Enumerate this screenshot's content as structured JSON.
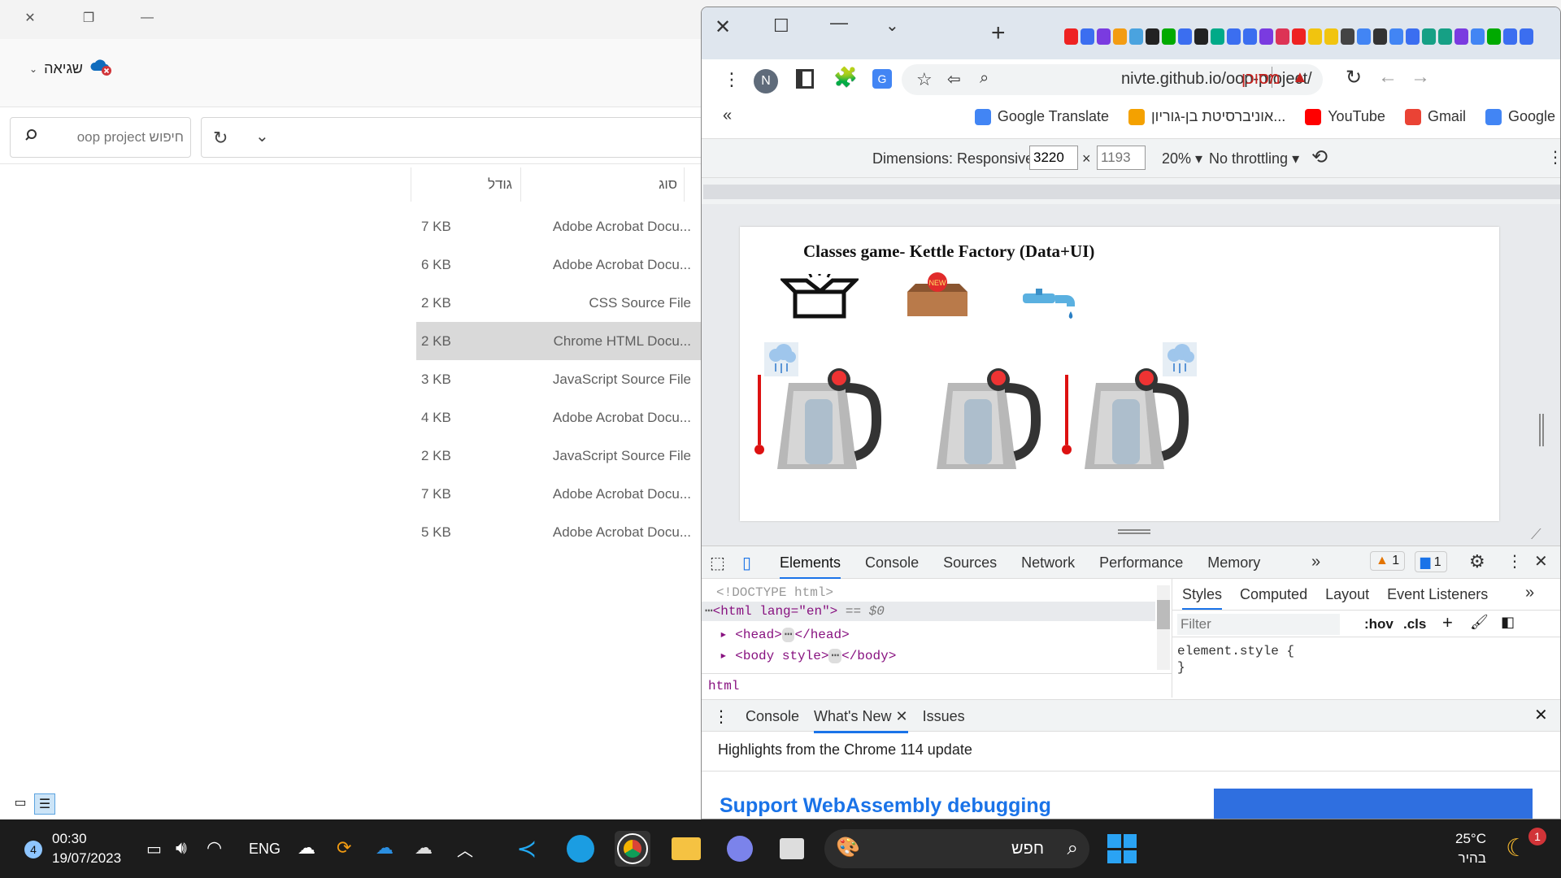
{
  "explorer": {
    "status_label": "שגיאה",
    "search_placeholder": "חיפוש oop project",
    "columns": {
      "type": "סוג",
      "size": "גודל"
    },
    "rows": [
      {
        "size": "7 KB",
        "type": "Adobe Acrobat Docu..."
      },
      {
        "size": "6 KB",
        "type": "Adobe Acrobat Docu..."
      },
      {
        "size": "2 KB",
        "type": "CSS Source File"
      },
      {
        "size": "2 KB",
        "type": "Chrome HTML Docu...",
        "selected": true
      },
      {
        "size": "3 KB",
        "type": "JavaScript Source File"
      },
      {
        "size": "4 KB",
        "type": "Adobe Acrobat Docu..."
      },
      {
        "size": "2 KB",
        "type": "JavaScript Source File"
      },
      {
        "size": "7 KB",
        "type": "Adobe Acrobat Docu..."
      },
      {
        "size": "5 KB",
        "type": "Adobe Acrobat Docu..."
      }
    ]
  },
  "chrome": {
    "profile_initial": "N",
    "url": "nivte.github.io/oop-project/",
    "security_label": "מסוכן",
    "bookmarks": [
      {
        "label": "Google",
        "icon": "google-icon",
        "color": "#4285f4"
      },
      {
        "label": "Gmail",
        "icon": "gmail-icon",
        "color": "#ea4335"
      },
      {
        "label": "YouTube",
        "icon": "youtube-icon",
        "color": "#ff0000"
      },
      {
        "label": "אוניברסיטת בן-גוריון...",
        "icon": "bgu-icon",
        "color": "#f4a100"
      },
      {
        "label": "Google Translate",
        "icon": "translate-icon",
        "color": "#4285f4"
      }
    ],
    "device_toolbar": {
      "dimensions": "Dimensions: Responsive",
      "width": "3220",
      "height": "1193",
      "zoom": "20%",
      "throttling": "No throttling"
    },
    "page": {
      "title": "Classes game- Kettle Factory (Data+UI)"
    },
    "devtools": {
      "tabs": [
        "Elements",
        "Console",
        "Sources",
        "Network",
        "Performance",
        "Memory"
      ],
      "warnings": "1",
      "messages": "1",
      "dom_lines": [
        "<!DOCTYPE html>",
        "<html lang=\"en\">",
        "== $0",
        "<head>",
        "</head>",
        "<body style>",
        "</body>"
      ],
      "breadcrumb": "html",
      "styles_tabs": [
        "Styles",
        "Computed",
        "Layout",
        "Event Listeners"
      ],
      "filter_placeholder": "Filter",
      "hov": ":hov",
      "cls": ".cls",
      "element_style": "element.style {",
      "close_brace": "}",
      "drawer_tabs": [
        "Console",
        "What's New",
        "Issues"
      ],
      "highlights": "Highlights from the Chrome 114 update",
      "feature_title": "Support WebAssembly debugging"
    }
  },
  "taskbar": {
    "notification_count": "4",
    "time": "00:30",
    "date": "19/07/2023",
    "language": "ENG",
    "search_label": "חפש",
    "weather_temp": "25°C",
    "weather_desc": "בהיר",
    "weather_badge": "1"
  }
}
